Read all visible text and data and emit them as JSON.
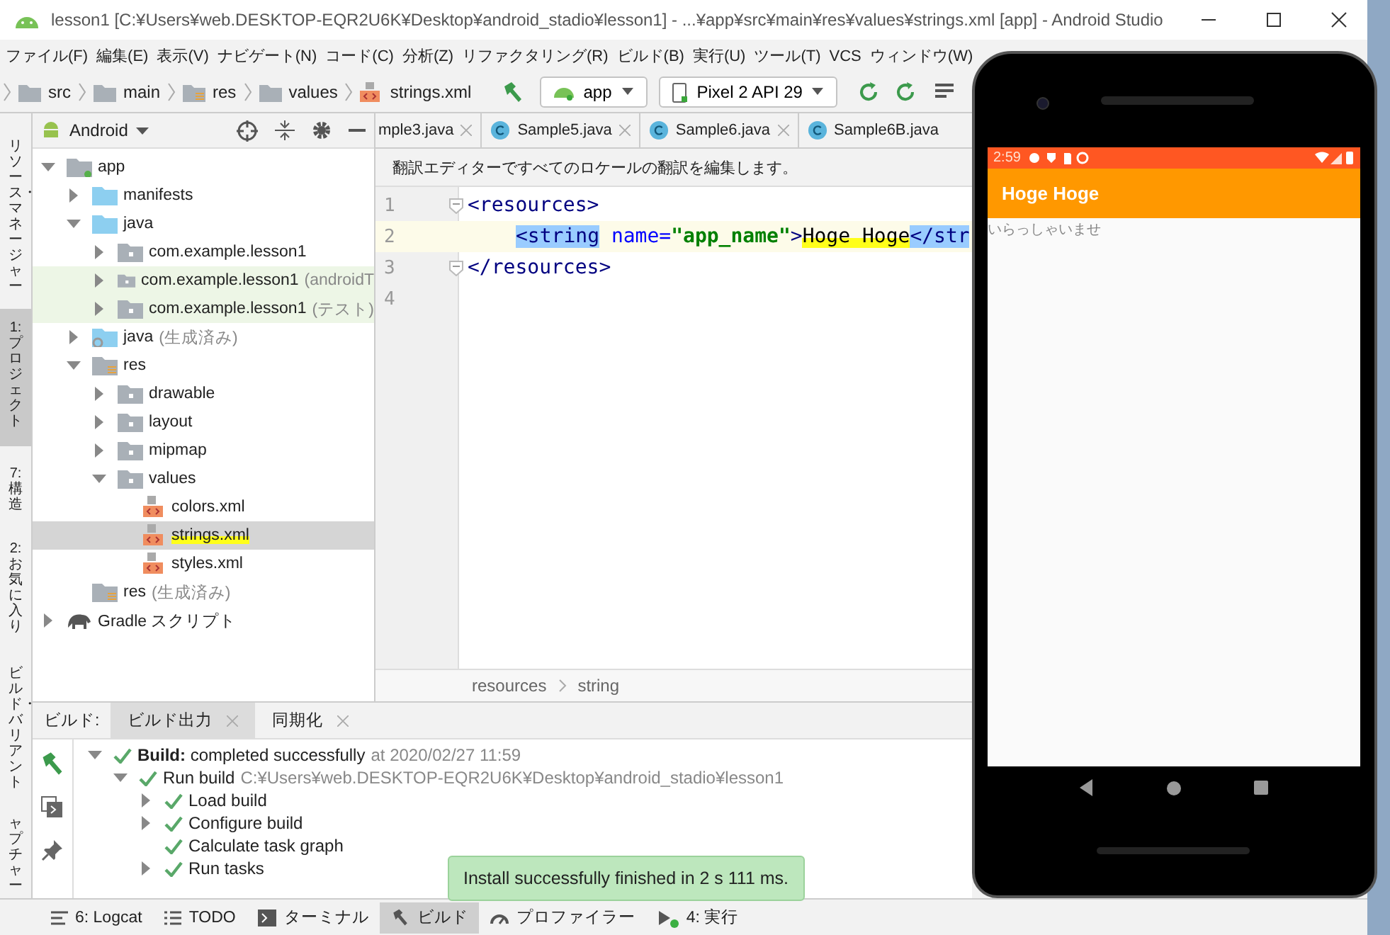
{
  "window": {
    "title": "lesson1 [C:¥Users¥web.DESKTOP-EQR2U6K¥Desktop¥android_stadio¥lesson1] - ...¥app¥src¥main¥res¥values¥strings.xml [app] - Android Studio"
  },
  "menu": [
    "ファイル(F)",
    "編集(E)",
    "表示(V)",
    "ナビゲート(N)",
    "コード(C)",
    "分析(Z)",
    "リファクタリング(R)",
    "ビルド(B)",
    "実行(U)",
    "ツール(T)",
    "VCS",
    "ウィンドウ(W)"
  ],
  "breadcrumb": [
    {
      "label": "src",
      "kind": "folder"
    },
    {
      "label": "main",
      "kind": "folder"
    },
    {
      "label": "res",
      "kind": "res"
    },
    {
      "label": "values",
      "kind": "folder"
    },
    {
      "label": "strings.xml",
      "kind": "xml"
    }
  ],
  "run_config": {
    "module": "app",
    "device": "Pixel 2 API 29"
  },
  "tool_strip": [
    {
      "label": "リソース・マネージャー",
      "selected": false
    },
    {
      "label": "1: プロジェクト",
      "selected": true
    },
    {
      "label": "7: 構造",
      "selected": false
    },
    {
      "label": "2: お気に入り",
      "selected": false
    },
    {
      "label": "ビルド・バリアント",
      "selected": false
    },
    {
      "label": "ャプチャー",
      "selected": false
    }
  ],
  "project_panel": {
    "view": "Android",
    "tree": [
      {
        "name": "app",
        "kind": "module",
        "expanded": true,
        "selected": false,
        "tinted": false,
        "children": [
          {
            "name": "manifests",
            "kind": "folder",
            "expanded": false,
            "selected": false,
            "tinted": false
          },
          {
            "name": "java",
            "kind": "folder",
            "expanded": true,
            "selected": false,
            "tinted": false,
            "children": [
              {
                "name": "com.example.lesson1",
                "kind": "package",
                "expanded": false,
                "selected": false,
                "tinted": false
              },
              {
                "name": "com.example.lesson1",
                "note": "(androidT",
                "kind": "package",
                "expanded": false,
                "selected": false,
                "tinted": true
              },
              {
                "name": "com.example.lesson1",
                "note": "(テスト)",
                "kind": "package",
                "expanded": false,
                "selected": false,
                "tinted": true
              }
            ]
          },
          {
            "name": "java",
            "note": "(生成済み)",
            "kind": "generated",
            "expanded": false,
            "selected": false,
            "tinted": false
          },
          {
            "name": "res",
            "kind": "res",
            "expanded": true,
            "selected": false,
            "tinted": false,
            "children": [
              {
                "name": "drawable",
                "kind": "package",
                "expanded": false,
                "selected": false,
                "tinted": false
              },
              {
                "name": "layout",
                "kind": "package",
                "expanded": false,
                "selected": false,
                "tinted": false
              },
              {
                "name": "mipmap",
                "kind": "package",
                "expanded": false,
                "selected": false,
                "tinted": false
              },
              {
                "name": "values",
                "kind": "package",
                "expanded": true,
                "selected": false,
                "tinted": false,
                "children": [
                  {
                    "name": "colors.xml",
                    "kind": "xml",
                    "selected": false,
                    "tinted": false,
                    "marked": false
                  },
                  {
                    "name": "strings.xml",
                    "kind": "xml",
                    "selected": true,
                    "tinted": false,
                    "marked": true
                  },
                  {
                    "name": "styles.xml",
                    "kind": "xml",
                    "selected": false,
                    "tinted": false,
                    "marked": false
                  }
                ]
              }
            ]
          },
          {
            "name": "res",
            "note": "(生成済み)",
            "kind": "res",
            "selected": false,
            "tinted": false
          }
        ]
      },
      {
        "name": "Gradle スクリプト",
        "kind": "gradle",
        "expanded": false,
        "selected": false,
        "tinted": false
      }
    ]
  },
  "editor": {
    "tabs": [
      {
        "label": "mple3.java",
        "selected": false,
        "closable": true,
        "icon": false
      },
      {
        "label": "Sample5.java",
        "selected": false,
        "closable": true,
        "icon": true
      },
      {
        "label": "Sample6.java",
        "selected": false,
        "closable": true,
        "icon": true
      },
      {
        "label": "Sample6B.java",
        "selected": false,
        "closable": false,
        "icon": true
      }
    ],
    "notice": "翻訳エディターですべてのロケールの翻訳を編集します。",
    "lines": [
      {
        "number": "1",
        "current": false,
        "fold": true,
        "tokens": [
          {
            "text": "<resources>",
            "kind": "tag",
            "matched": false,
            "marked": false
          }
        ],
        "children": [
          {
            "number": "2",
            "current": true,
            "fold": false,
            "tokens": [
              {
                "text": "<string",
                "kind": "tag",
                "matched": true,
                "marked": false
              },
              {
                "text": " name=",
                "kind": "attr",
                "matched": false,
                "marked": false
              },
              {
                "text": "\"app_name\"",
                "kind": "value",
                "matched": false,
                "marked": false
              },
              {
                "text": ">",
                "kind": "tag",
                "matched": false,
                "marked": false
              },
              {
                "text": "Hoge Hoge",
                "kind": "text",
                "matched": false,
                "marked": true
              },
              {
                "text": "</str",
                "kind": "tag",
                "matched": true,
                "marked": false
              }
            ]
          }
        ]
      },
      {
        "number": "3",
        "current": false,
        "fold": true,
        "tokens": [
          {
            "text": "</resources>",
            "kind": "tag",
            "matched": false,
            "marked": false
          }
        ]
      },
      {
        "number": "4",
        "current": false,
        "fold": false
      }
    ],
    "breadcrumb": [
      "resources",
      "string"
    ]
  },
  "build_panel": {
    "label": "ビルド:",
    "tabs": [
      {
        "label": "ビルド出力",
        "selected": true
      },
      {
        "label": "同期化",
        "selected": false
      }
    ],
    "tree": [
      {
        "text": "**Build:** completed successfully",
        "note": "at 2020/02/27 11:59",
        "expanded": true,
        "children": [
          {
            "text": "Run build",
            "note": "C:¥Users¥web.DESKTOP-EQR2U6K¥Desktop¥android_stadio¥lesson1",
            "expanded": true,
            "children": [
              {
                "text": "Load build",
                "expanded": false
              },
              {
                "text": "Configure build",
                "expanded": false
              },
              {
                "text": "Calculate task graph"
              },
              {
                "text": "Run tasks",
                "expanded": false
              }
            ]
          }
        ]
      }
    ]
  },
  "bottom_tools": [
    {
      "label": "6: Logcat",
      "kind": "logcat",
      "selected": false,
      "running": false
    },
    {
      "label": "TODO",
      "kind": "todo",
      "selected": false,
      "running": false
    },
    {
      "label": "ターミナル",
      "kind": "terminal",
      "selected": false,
      "running": false
    },
    {
      "label": "ビルド",
      "kind": "build",
      "selected": true,
      "running": false
    },
    {
      "label": "プロファイラー",
      "kind": "profiler",
      "selected": false,
      "running": false
    },
    {
      "label": "4: 実行",
      "kind": "run",
      "selected": false,
      "running": true
    }
  ],
  "toast": "Install successfully finished in 2 s 111 ms.",
  "emulator": {
    "time": "2:59",
    "app_title": "Hoge Hoge",
    "content": "いらっしゃいませ"
  }
}
